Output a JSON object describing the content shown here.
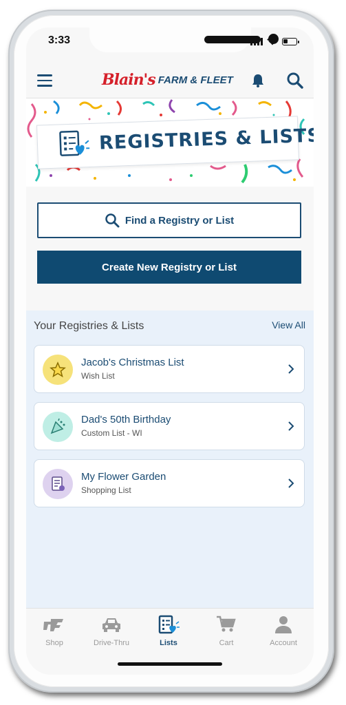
{
  "status_bar": {
    "time": "3:33"
  },
  "header": {
    "brand_script": "Blain's",
    "brand_name": "FARM & FLEET"
  },
  "banner": {
    "title": "REGISTRIES & LISTS"
  },
  "actions": {
    "find_label": "Find a Registry or List",
    "create_label": "Create New Registry or List"
  },
  "lists_section": {
    "title": "Your Registries & Lists",
    "view_all": "View All",
    "items": [
      {
        "name": "Jacob's Christmas List",
        "type": "Wish List",
        "icon": "star-icon",
        "color": "#f6e27a"
      },
      {
        "name": "Dad's 50th Birthday",
        "type": "Custom List - WI",
        "icon": "party-icon",
        "color": "#bfeee5"
      },
      {
        "name": "My Flower Garden",
        "type": "Shopping List",
        "icon": "checklist-icon",
        "color": "#ded2ef"
      }
    ]
  },
  "tabbar": {
    "tabs": [
      {
        "label": "Shop",
        "icon": "shop-logo-icon"
      },
      {
        "label": "Drive-Thru",
        "icon": "car-icon"
      },
      {
        "label": "Lists",
        "icon": "lists-icon",
        "active": true
      },
      {
        "label": "Cart",
        "icon": "cart-icon"
      },
      {
        "label": "Account",
        "icon": "account-icon"
      }
    ]
  },
  "colors": {
    "brand_blue": "#1b4c73",
    "brand_red": "#d5202a",
    "section_bg": "#e9f1fa"
  }
}
